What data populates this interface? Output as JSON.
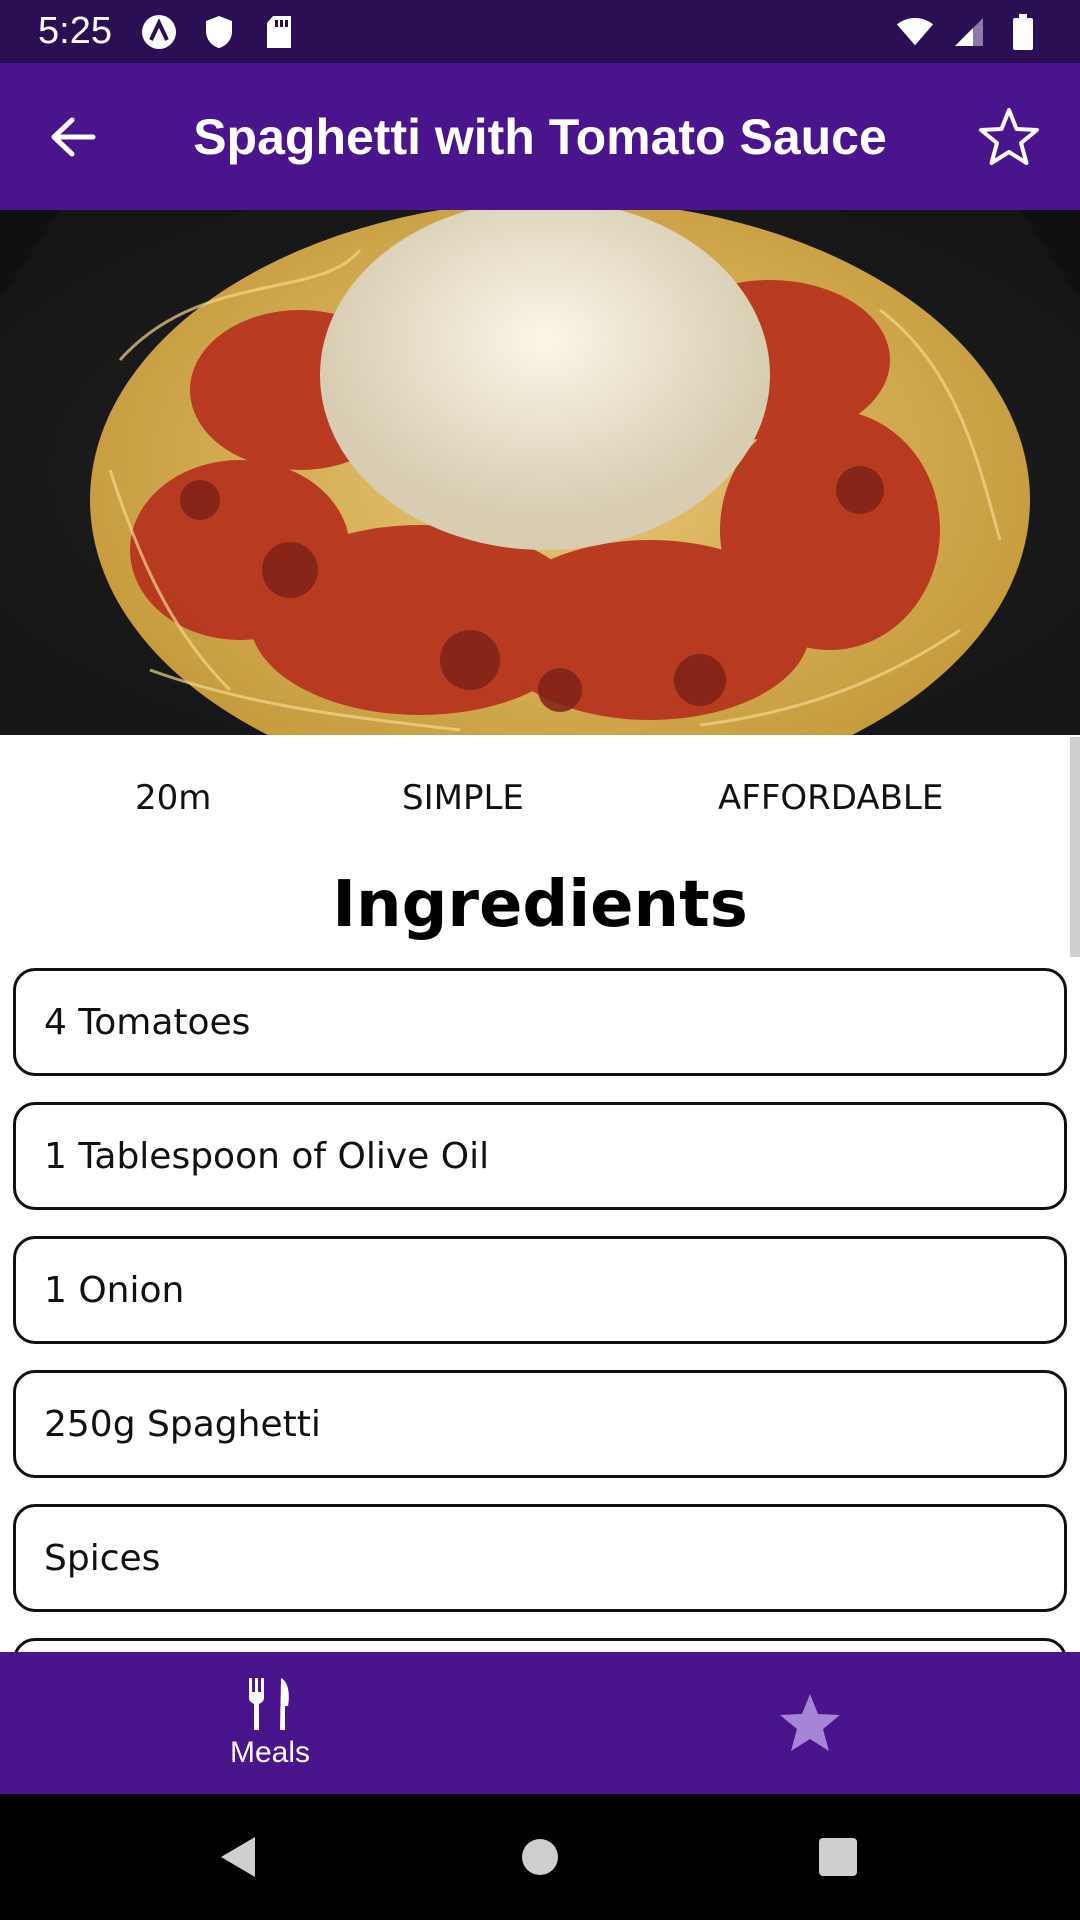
{
  "status_bar": {
    "time": "5:25",
    "icons_left": [
      "app-logo-icon",
      "shield-icon",
      "sd-card-icon"
    ],
    "icons_right": [
      "wifi-icon",
      "cell-signal-icon",
      "battery-icon"
    ]
  },
  "app_bar": {
    "title": "Spaghetti with Tomato Sauce",
    "back_icon": "arrow-back-icon",
    "favorite_icon": "star-outline-icon"
  },
  "meal": {
    "duration": "20m",
    "complexity": "SIMPLE",
    "affordability": "AFFORDABLE"
  },
  "ingredients_section": {
    "title": "Ingredients",
    "items": [
      "4 Tomatoes",
      "1 Tablespoon of Olive Oil",
      "1 Onion",
      "250g Spaghetti",
      "Spices"
    ]
  },
  "bottom_nav": {
    "items": [
      {
        "label": "Meals",
        "icon": "restaurant-icon",
        "active": true
      },
      {
        "label": "",
        "icon": "star-icon",
        "active": false
      }
    ],
    "colors": {
      "background": "#4a148c",
      "active": "#ffffff",
      "inactive": "#a685d6"
    }
  },
  "colors": {
    "status_bar": "#2a0f55",
    "app_bar": "#4a148c"
  }
}
